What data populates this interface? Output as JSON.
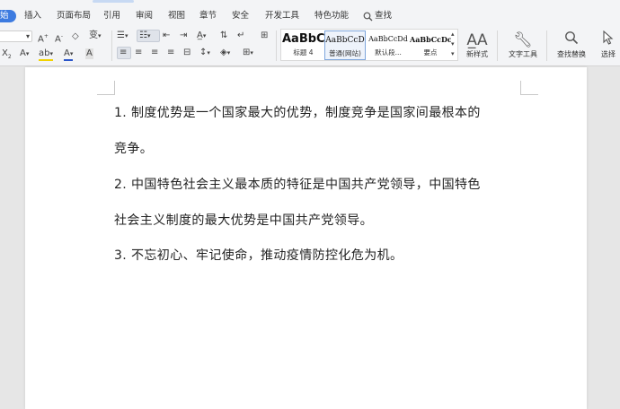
{
  "menu": {
    "home": "始",
    "insert": "插入",
    "page_layout": "页面布局",
    "references": "引用",
    "review": "审阅",
    "view": "视图",
    "chapter": "章节",
    "security": "安全",
    "dev_tools": "开发工具",
    "features": "特色功能",
    "search": "查找"
  },
  "toolbar": {
    "styles": [
      {
        "sample": "AaBbC",
        "name": "标题 4"
      },
      {
        "sample": "AaBbCcD",
        "name": "普通(网站)"
      },
      {
        "sample": "AaBbCcDd",
        "name": "默认段..."
      },
      {
        "sample": "AaBbCcDc",
        "name": "要点"
      }
    ],
    "new_style": "新样式",
    "text_tools": "文字工具",
    "find_replace": "查找替换",
    "select": "选择"
  },
  "document": {
    "paragraphs": [
      {
        "line1": "1. 制度优势是一个国家最大的优势，制度竞争是国家间最根本的",
        "line2": "竞争。"
      },
      {
        "line1": "2. 中国特色社会主义最本质的特征是中国共产党领导，中国特色",
        "line2": "社会主义制度的最大优势是中国共产党领导。"
      },
      {
        "line1": "3. 不忘初心、牢记使命，推动疫情防控化危为机。",
        "line2": ""
      }
    ]
  },
  "colors": {
    "accent": "#3d7be0",
    "font_color_underline": "#2a55c9",
    "highlight_underline": "#f2d200"
  }
}
